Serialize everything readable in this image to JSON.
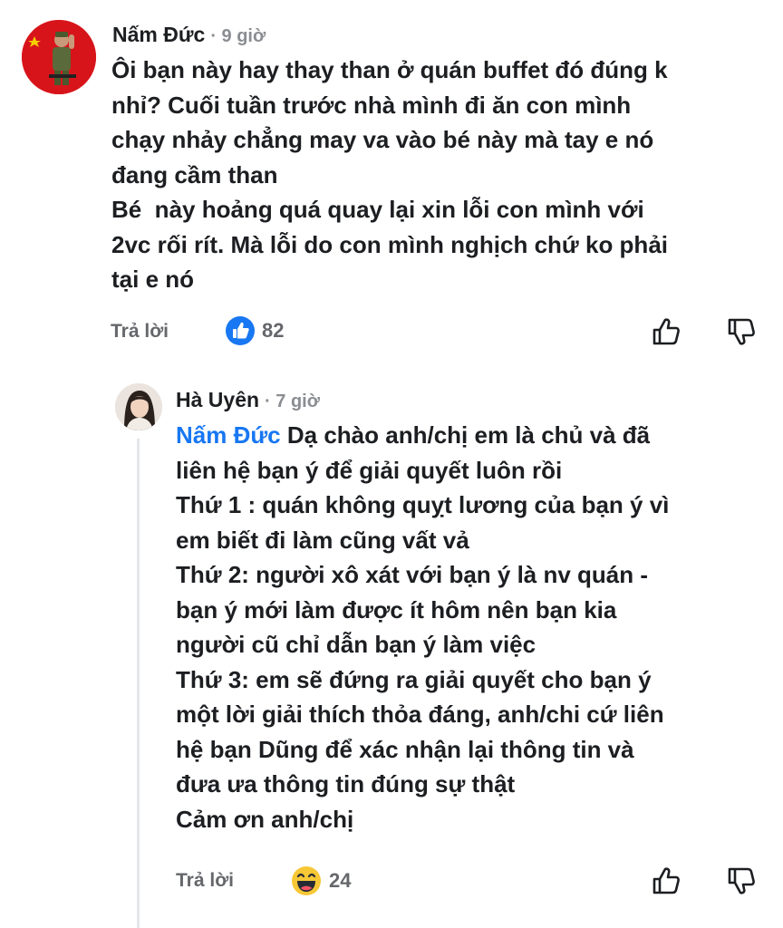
{
  "comment1": {
    "author": "Nấm Đức",
    "time": "· 9 giờ",
    "lines": [
      "Ôi bạn này hay thay than ở quán buffet đó đúng k",
      "nhỉ? Cuối tuần trước nhà mình đi ăn con mình",
      "chạy nhảy chẳng may va vào bé này mà tay e nó",
      "đang cầm than",
      "Bé  này hoảng quá quay lại xin lỗi con mình với",
      "2vc rối rít. Mà lỗi do con mình nghịch chứ ko phải",
      "tại e nó"
    ],
    "reply_label": "Trả lời",
    "reaction_icon": "like-reaction-icon",
    "reaction_count": "82"
  },
  "comment2": {
    "author": "Hà Uyên",
    "time": "· 7 giờ",
    "mention": "Nấm Đức",
    "first_line_rest": " Dạ chào anh/chị em là chủ và đã",
    "lines": [
      "liên hệ bạn ý để giải quyết luôn rồi",
      "Thứ 1 : quán không quỵt lương của bạn ý vì",
      "em biết đi làm cũng vất vả",
      "Thứ 2: người xô xát với bạn ý là nv quán -",
      "bạn ý mới làm được ít hôm nên bạn kia",
      "người cũ chỉ dẫn bạn ý làm việc",
      "Thứ 3: em sẽ đứng ra giải quyết cho bạn ý",
      "một lời giải thích thỏa đáng, anh/chi cứ liên",
      "hệ bạn Dũng để xác nhận lại thông tin và",
      "đưa ưa thông tin đúng sự thật",
      "Cảm ơn anh/chị"
    ],
    "reply_label": "Trả lời",
    "reaction_icon": "haha-reaction-icon",
    "reaction_count": "24"
  },
  "colors": {
    "mention": "#1877f2",
    "like_blue": "#1877f2",
    "haha_yellow": "#f7c836"
  }
}
